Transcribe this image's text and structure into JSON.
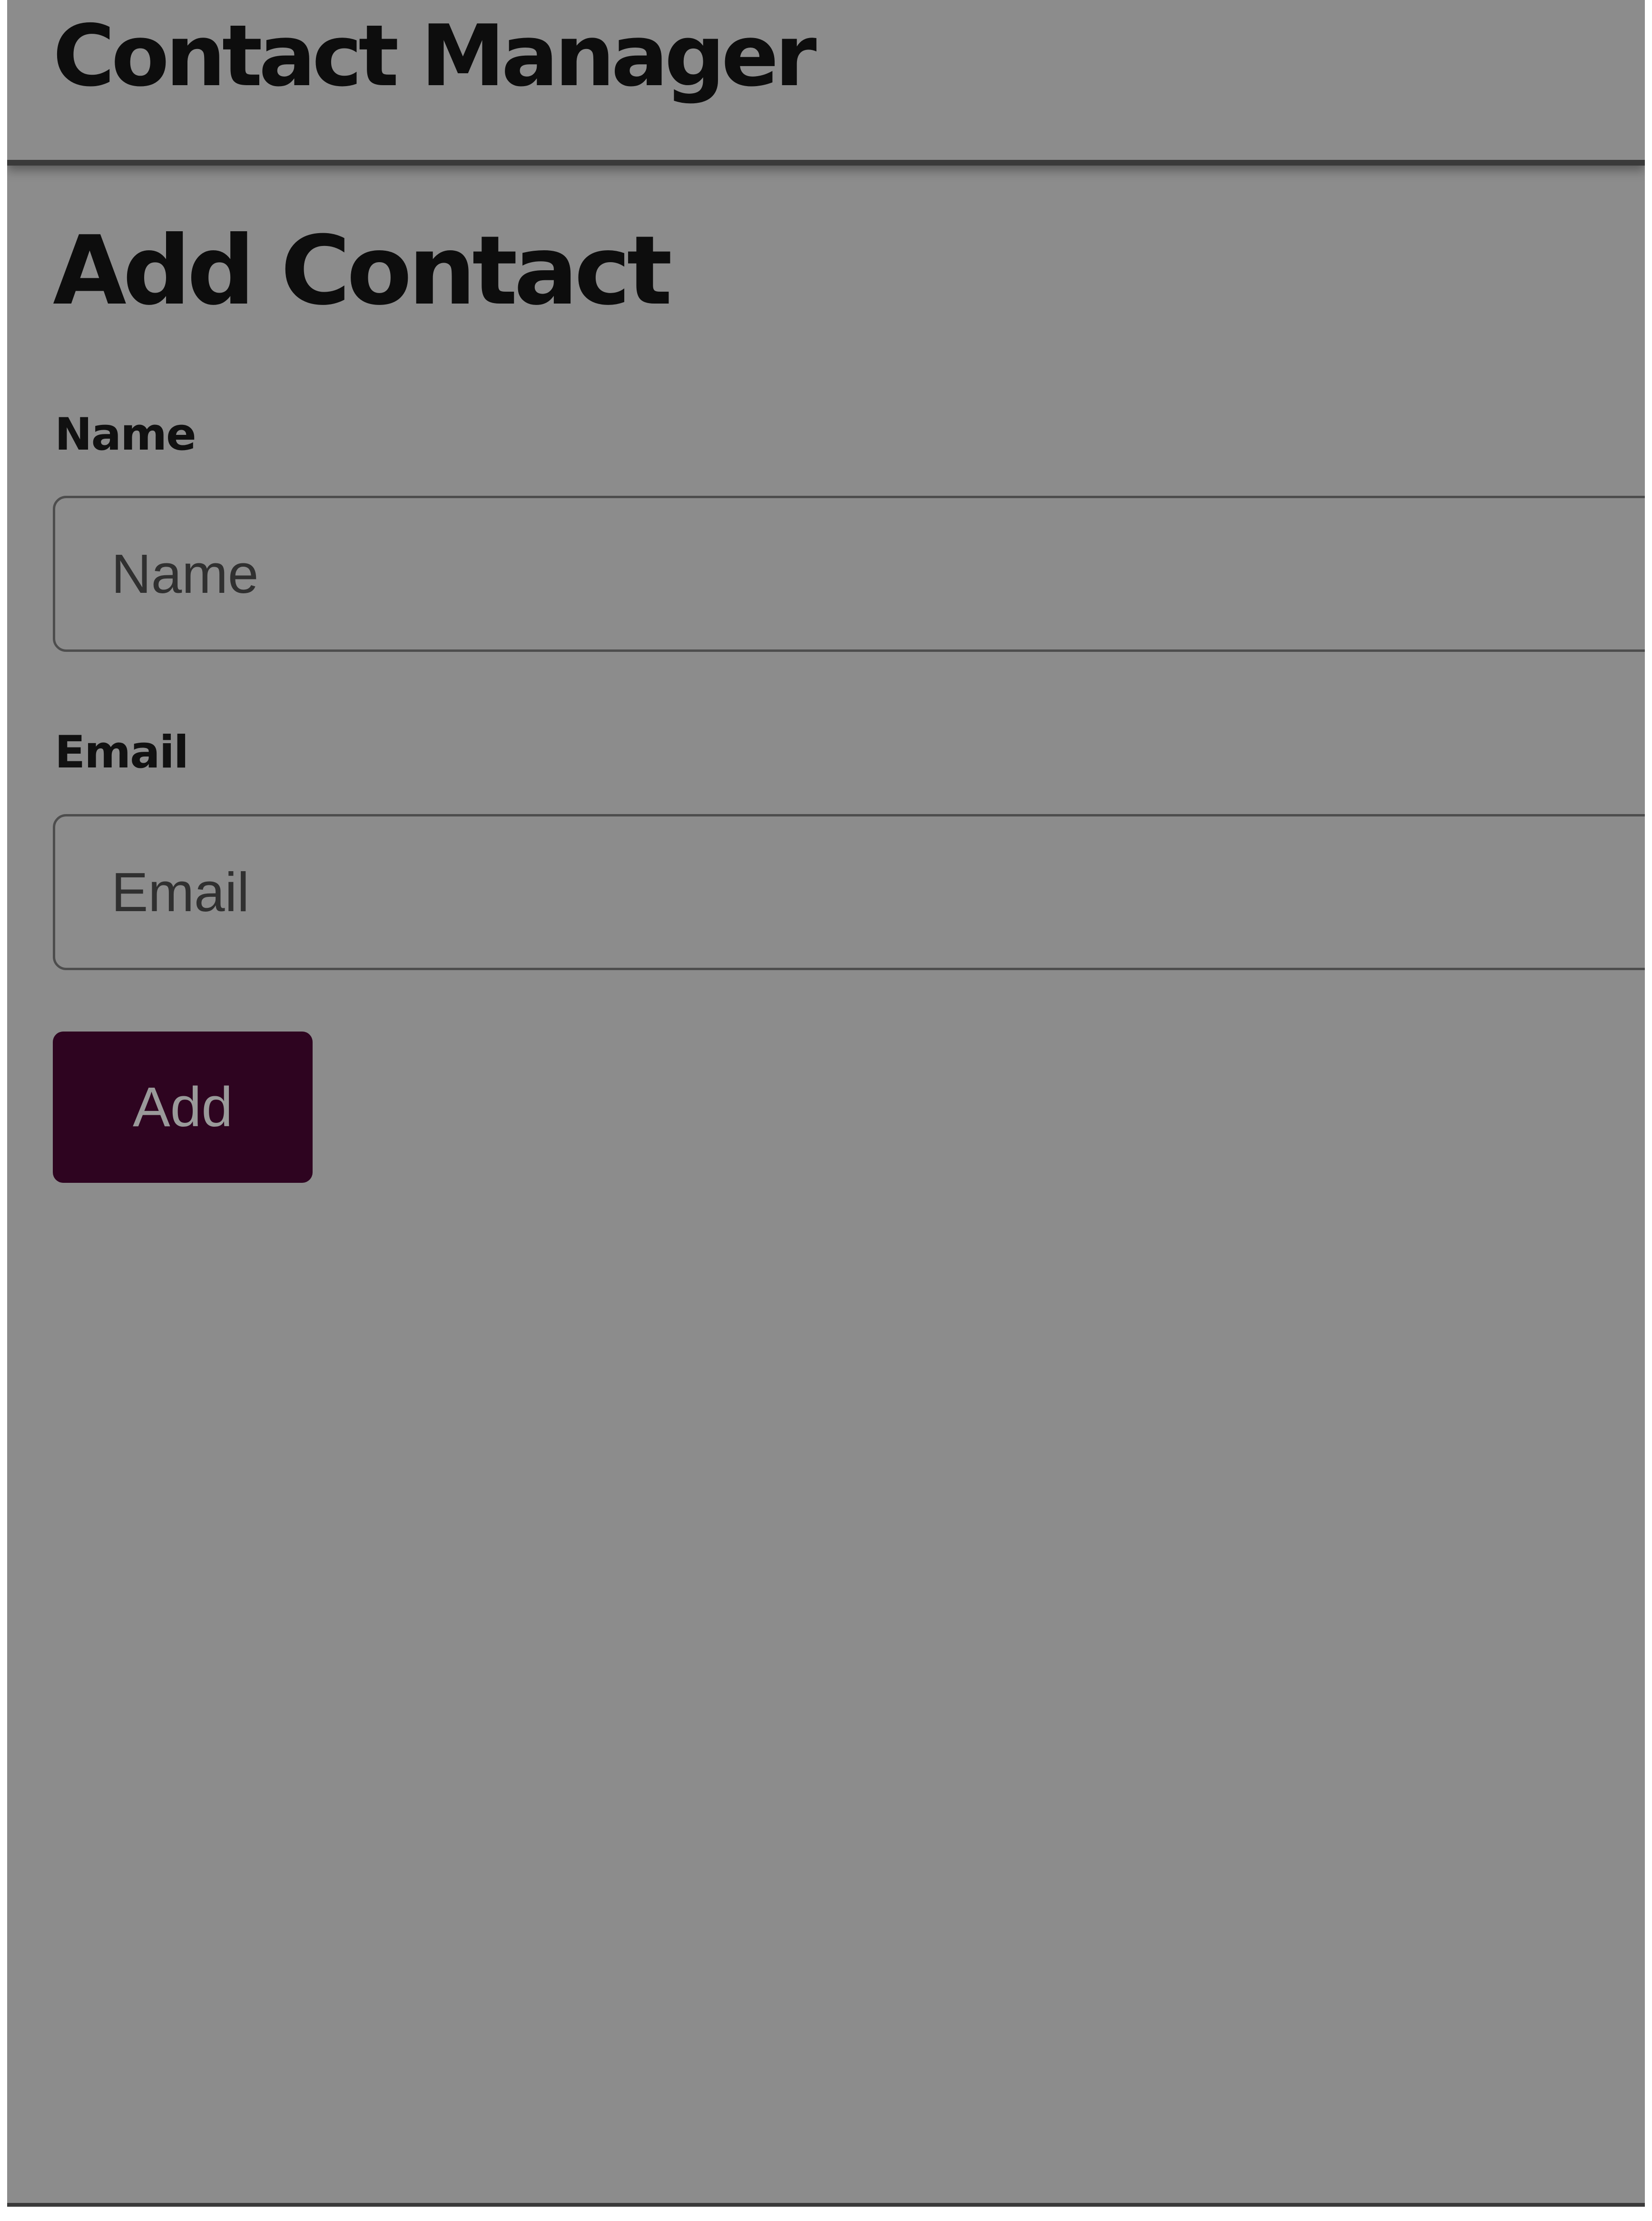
{
  "header": {
    "title": "Contact Manager"
  },
  "form": {
    "title": "Add Contact",
    "name": {
      "label": "Name",
      "value": "",
      "placeholder": "Name"
    },
    "email": {
      "label": "Email",
      "value": "",
      "placeholder": "Email"
    },
    "submit_label": "Add"
  },
  "colors": {
    "background": "#8c8c8c",
    "button": "#2e0420",
    "button_text": "#9a9a9a",
    "text": "#0d0d0d"
  }
}
